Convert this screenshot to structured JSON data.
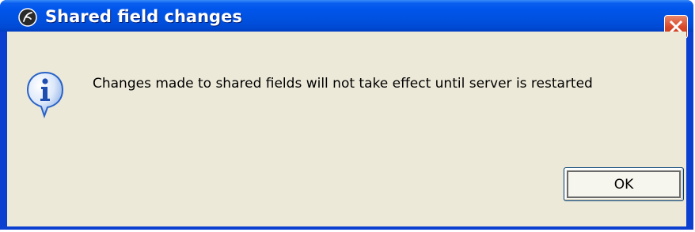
{
  "dialog": {
    "title": "Shared field changes",
    "message": "Changes made to shared fields will not take effect until server is restarted",
    "ok_label": "OK",
    "icons": {
      "app": "app-logo-icon",
      "close": "close-icon",
      "message": "information-icon"
    },
    "colors": {
      "titlebar": "#0055ea",
      "frame": "#0a3fd0",
      "client_background": "#ece9d8",
      "close_button": "#d9492a",
      "info_icon": "#2a64c8"
    }
  }
}
